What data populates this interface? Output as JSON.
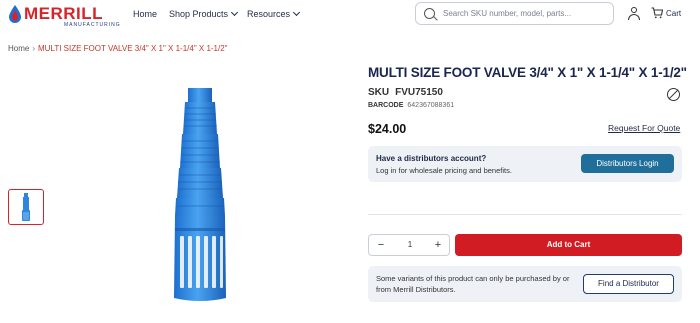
{
  "brand": {
    "name": "MERRILL",
    "sub": "MANUFACTURING",
    "accent": "#d8232a",
    "secondary": "#1f3c88"
  },
  "nav": {
    "items": [
      {
        "label": "Home"
      },
      {
        "label": "Shop Products"
      },
      {
        "label": "Resources"
      }
    ]
  },
  "search": {
    "placeholder": "Search SKU number, model, parts...",
    "icon": "search-icon"
  },
  "header_actions": {
    "account_icon": "user-icon",
    "cart_icon": "cart-icon",
    "cart_label": "Cart"
  },
  "breadcrumb": {
    "home": "Home",
    "separator": "›",
    "current": "MULTI SIZE FOOT VALVE 3/4\" X 1\" X 1-1/4\" X 1-1/2\""
  },
  "product": {
    "title": "MULTI SIZE FOOT VALVE 3/4\" X 1\" X 1-1/4\" X 1-1/2\"",
    "sku_label": "SKU",
    "sku": "FVU75150",
    "barcode_label": "BARCODE",
    "barcode": "642367088361",
    "price": "$24.00",
    "request_quote": "Request For Quote",
    "image_color": "#2f86e0"
  },
  "distributor_box": {
    "title": "Have a distributors account?",
    "subtitle": "Log in for wholesale pricing and benefits.",
    "button": "Distributors Login",
    "button_color": "#1f6f9a"
  },
  "purchase": {
    "qty_minus": "−",
    "quantity": "1",
    "qty_plus": "+",
    "add_to_cart": "Add to Cart",
    "add_to_cart_color": "#d01c22"
  },
  "variant_box": {
    "text": "Some variants of this product can only be purchased by or from Merrill Distributors.",
    "button": "Find a Distributor"
  }
}
